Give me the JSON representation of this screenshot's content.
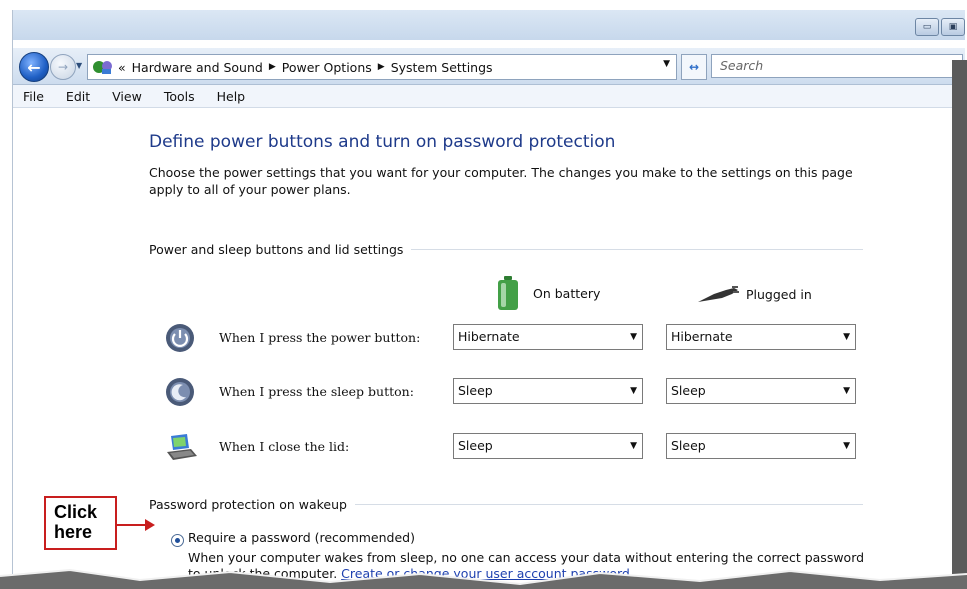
{
  "address_bar": {
    "overflow": "«",
    "crumbs": [
      "Hardware and Sound",
      "Power Options",
      "System Settings"
    ],
    "search_placeholder": "Search"
  },
  "menu": [
    "File",
    "Edit",
    "View",
    "Tools",
    "Help"
  ],
  "page": {
    "title": "Define power buttons and turn on password protection",
    "description": "Choose the power settings that you want for your computer. The changes you make to the settings on this page apply to all of your power plans."
  },
  "section_buttons": {
    "heading": "Power and sleep buttons and lid settings",
    "col_battery": "On battery",
    "col_plugged": "Plugged in",
    "rows": [
      {
        "label": "When I press the power button:",
        "battery": "Hibernate",
        "plugged": "Hibernate"
      },
      {
        "label": "When I press the sleep button:",
        "battery": "Sleep",
        "plugged": "Sleep"
      },
      {
        "label": "When I close the lid:",
        "battery": "Sleep",
        "plugged": "Sleep"
      }
    ]
  },
  "section_password": {
    "heading": "Password protection on wakeup",
    "option_label": "Require a password (recommended)",
    "option_selected": true,
    "explanation": "When your computer wakes from sleep, no one can access your data without entering the correct password to unlock the computer.",
    "link": "Create or change your user account password"
  },
  "callout": {
    "line1": "Click",
    "line2": "here"
  },
  "colors": {
    "accent": "#1e3a8a",
    "callout": "#c81e1e",
    "link": "#1e40af"
  }
}
